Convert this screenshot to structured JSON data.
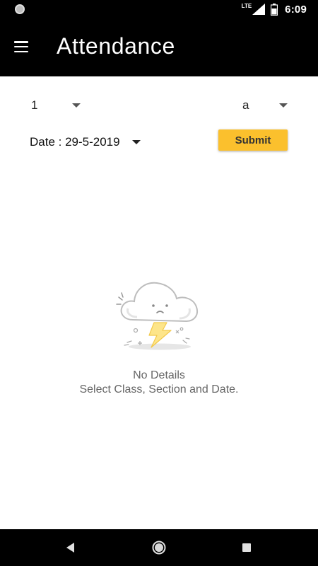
{
  "status_bar": {
    "network": "LTE",
    "time": "6:09",
    "icons": [
      "notification-circle-icon",
      "signal-icon",
      "battery-icon"
    ]
  },
  "app_bar": {
    "title": "Attendance",
    "menu_icon": "hamburger-menu-icon"
  },
  "filters": {
    "class_value": "1",
    "section_value": "a",
    "date_label": "Date : 29-5-2019",
    "submit_label": "Submit"
  },
  "empty_state": {
    "icon": "sad-cloud-lightning-icon",
    "title": "No Details",
    "subtitle": "Select Class, Section and Date."
  },
  "nav_bar": {
    "icons": [
      "back-icon",
      "home-icon",
      "recents-icon"
    ]
  },
  "colors": {
    "bars": "#000000",
    "accent": "#fbc02d",
    "empty_text": "#666666"
  }
}
